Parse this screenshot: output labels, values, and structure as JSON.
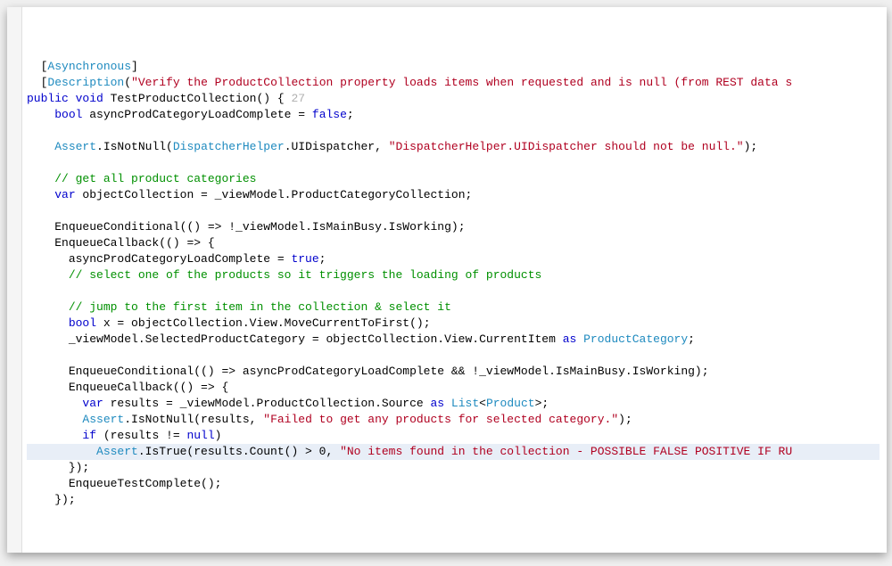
{
  "code": {
    "lines": [
      {
        "indent": 1,
        "tokens": [
          {
            "t": "id",
            "v": "["
          },
          {
            "t": "ty",
            "v": "Asynchronous"
          },
          {
            "t": "id",
            "v": "]"
          }
        ]
      },
      {
        "indent": 1,
        "tokens": [
          {
            "t": "id",
            "v": "["
          },
          {
            "t": "ty",
            "v": "Description"
          },
          {
            "t": "id",
            "v": "("
          },
          {
            "t": "st",
            "v": "\"Verify the ProductCollection property loads items when requested and is null (from REST data s"
          }
        ]
      },
      {
        "indent": 0,
        "tokens": [
          {
            "t": "kw",
            "v": "public void"
          },
          {
            "t": "id",
            "v": " TestProductCollection() { "
          },
          {
            "t": "dim",
            "v": "27"
          }
        ]
      },
      {
        "indent": 2,
        "tokens": [
          {
            "t": "kw",
            "v": "bool"
          },
          {
            "t": "id",
            "v": " asyncProdCategoryLoadComplete = "
          },
          {
            "t": "kw",
            "v": "false"
          },
          {
            "t": "id",
            "v": ";"
          }
        ]
      },
      {
        "indent": 0,
        "tokens": []
      },
      {
        "indent": 2,
        "tokens": [
          {
            "t": "ty",
            "v": "Assert"
          },
          {
            "t": "id",
            "v": ".IsNotNull("
          },
          {
            "t": "ty",
            "v": "DispatcherHelper"
          },
          {
            "t": "id",
            "v": ".UIDispatcher, "
          },
          {
            "t": "st",
            "v": "\"DispatcherHelper.UIDispatcher should not be null.\""
          },
          {
            "t": "id",
            "v": ");"
          }
        ]
      },
      {
        "indent": 0,
        "tokens": []
      },
      {
        "indent": 2,
        "tokens": [
          {
            "t": "cm",
            "v": "// get all product categories"
          }
        ]
      },
      {
        "indent": 2,
        "tokens": [
          {
            "t": "kw",
            "v": "var"
          },
          {
            "t": "id",
            "v": " objectCollection = _viewModel.ProductCategoryCollection;"
          }
        ]
      },
      {
        "indent": 0,
        "tokens": []
      },
      {
        "indent": 2,
        "tokens": [
          {
            "t": "id",
            "v": "EnqueueConditional(() => !_viewModel.IsMainBusy.IsWorking);"
          }
        ]
      },
      {
        "indent": 2,
        "tokens": [
          {
            "t": "id",
            "v": "EnqueueCallback(() => {"
          }
        ]
      },
      {
        "indent": 3,
        "tokens": [
          {
            "t": "id",
            "v": "asyncProdCategoryLoadComplete = "
          },
          {
            "t": "kw",
            "v": "true"
          },
          {
            "t": "id",
            "v": ";"
          }
        ]
      },
      {
        "indent": 3,
        "tokens": [
          {
            "t": "cm",
            "v": "// select one of the products so it triggers the loading of products"
          }
        ]
      },
      {
        "indent": 0,
        "tokens": []
      },
      {
        "indent": 3,
        "tokens": [
          {
            "t": "cm",
            "v": "// jump to the first item in the collection & select it"
          }
        ]
      },
      {
        "indent": 3,
        "tokens": [
          {
            "t": "kw",
            "v": "bool"
          },
          {
            "t": "id",
            "v": " x = objectCollection.View.MoveCurrentToFirst();"
          }
        ]
      },
      {
        "indent": 3,
        "tokens": [
          {
            "t": "id",
            "v": "_viewModel.SelectedProductCategory = objectCollection.View.CurrentItem "
          },
          {
            "t": "kw",
            "v": "as"
          },
          {
            "t": "id",
            "v": " "
          },
          {
            "t": "ty",
            "v": "ProductCategory"
          },
          {
            "t": "id",
            "v": ";"
          }
        ]
      },
      {
        "indent": 0,
        "tokens": []
      },
      {
        "indent": 3,
        "tokens": [
          {
            "t": "id",
            "v": "EnqueueConditional(() => asyncProdCategoryLoadComplete && !_viewModel.IsMainBusy.IsWorking);"
          }
        ]
      },
      {
        "indent": 3,
        "tokens": [
          {
            "t": "id",
            "v": "EnqueueCallback(() => {"
          }
        ]
      },
      {
        "indent": 4,
        "tokens": [
          {
            "t": "kw",
            "v": "var"
          },
          {
            "t": "id",
            "v": " results = _viewModel.ProductCollection.Source "
          },
          {
            "t": "kw",
            "v": "as"
          },
          {
            "t": "id",
            "v": " "
          },
          {
            "t": "ty",
            "v": "List"
          },
          {
            "t": "id",
            "v": "<"
          },
          {
            "t": "ty",
            "v": "Product"
          },
          {
            "t": "id",
            "v": ">;"
          }
        ]
      },
      {
        "indent": 4,
        "tokens": [
          {
            "t": "ty",
            "v": "Assert"
          },
          {
            "t": "id",
            "v": ".IsNotNull(results, "
          },
          {
            "t": "st",
            "v": "\"Failed to get any products for selected category.\""
          },
          {
            "t": "id",
            "v": ");"
          }
        ]
      },
      {
        "indent": 4,
        "tokens": [
          {
            "t": "kw",
            "v": "if"
          },
          {
            "t": "id",
            "v": " (results != "
          },
          {
            "t": "kw",
            "v": "null"
          },
          {
            "t": "id",
            "v": ")"
          }
        ]
      },
      {
        "indent": 5,
        "hl": true,
        "tokens": [
          {
            "t": "ty",
            "v": "Assert"
          },
          {
            "t": "id",
            "v": ".IsTrue(results.Count() > 0, "
          },
          {
            "t": "st",
            "v": "\"No items found in the collection - POSSIBLE FALSE POSITIVE IF RU"
          }
        ]
      },
      {
        "indent": 3,
        "tokens": [
          {
            "t": "id",
            "v": "});"
          }
        ]
      },
      {
        "indent": 3,
        "tokens": [
          {
            "t": "id",
            "v": "EnqueueTestComplete();"
          }
        ]
      },
      {
        "indent": 2,
        "tokens": [
          {
            "t": "id",
            "v": "});"
          }
        ]
      }
    ],
    "indent_unit": "  "
  }
}
